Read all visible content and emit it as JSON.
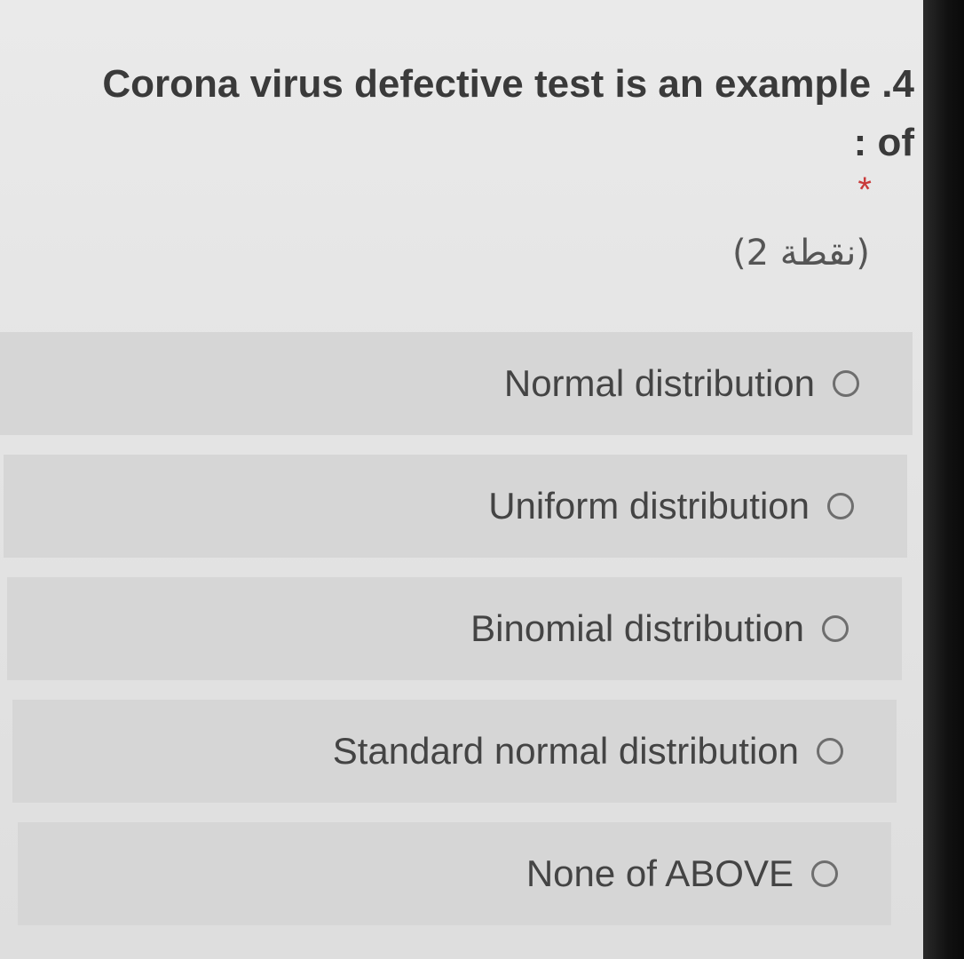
{
  "question": {
    "line1": "Corona virus defective test is an example .4",
    "line2": ": of",
    "required_mark": "*",
    "points": "(2 نقطة)"
  },
  "options": [
    {
      "label": "Normal distribution"
    },
    {
      "label": "Uniform distribution"
    },
    {
      "label": "Binomial distribution"
    },
    {
      "label": "Standard normal distribution"
    },
    {
      "label": "None of ABOVE"
    }
  ],
  "colors": {
    "required": "#c93a3a",
    "option_bg": "#d6d6d6",
    "text": "#444444"
  }
}
